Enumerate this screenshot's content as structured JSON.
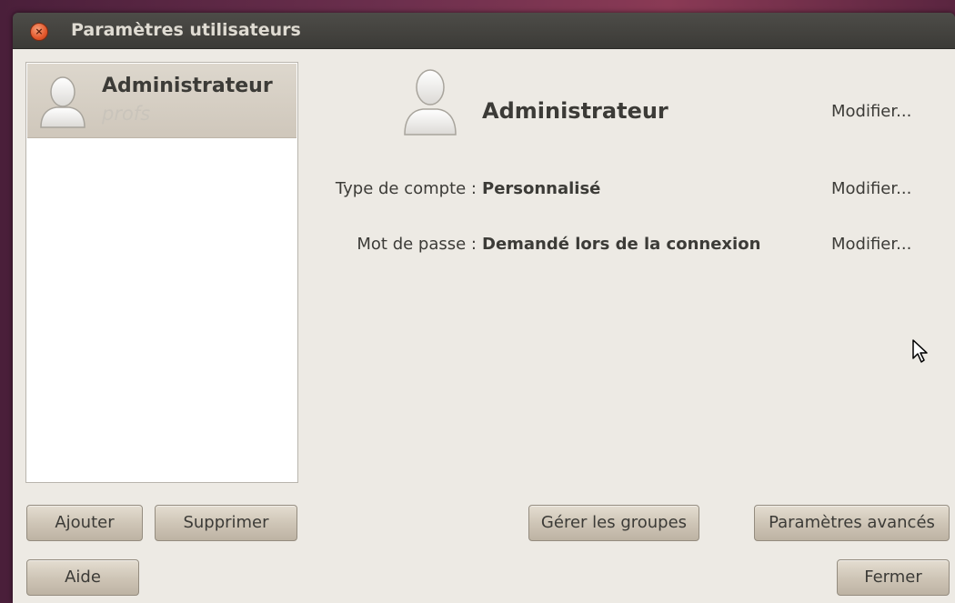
{
  "window": {
    "title": "Paramètres utilisateurs",
    "close_symbol": "×"
  },
  "user_list": [
    {
      "name": "Administrateur",
      "group": "profs",
      "selected": true
    }
  ],
  "details": {
    "name": "Administrateur",
    "name_modify_label": "Modifier...",
    "account_type_label": "Type de compte :",
    "account_type_value": "Personnalisé",
    "account_type_modify_label": "Modifier...",
    "password_label": "Mot de passe :",
    "password_value": "Demandé lors de la connexion",
    "password_modify_label": "Modifier..."
  },
  "buttons": {
    "add": "Ajouter",
    "remove": "Supprimer",
    "manage_groups": "Gérer les groupes",
    "advanced_settings": "Paramètres avancés",
    "help": "Aide",
    "close": "Fermer"
  },
  "icons": {
    "close": "close-icon",
    "avatar": "user-avatar-icon",
    "cursor": "mouse-pointer-icon"
  },
  "colors": {
    "titlebar": "#3c3b37",
    "close_button": "#e2572b",
    "selection": "#d6cfc3",
    "background": "#edeae4"
  }
}
